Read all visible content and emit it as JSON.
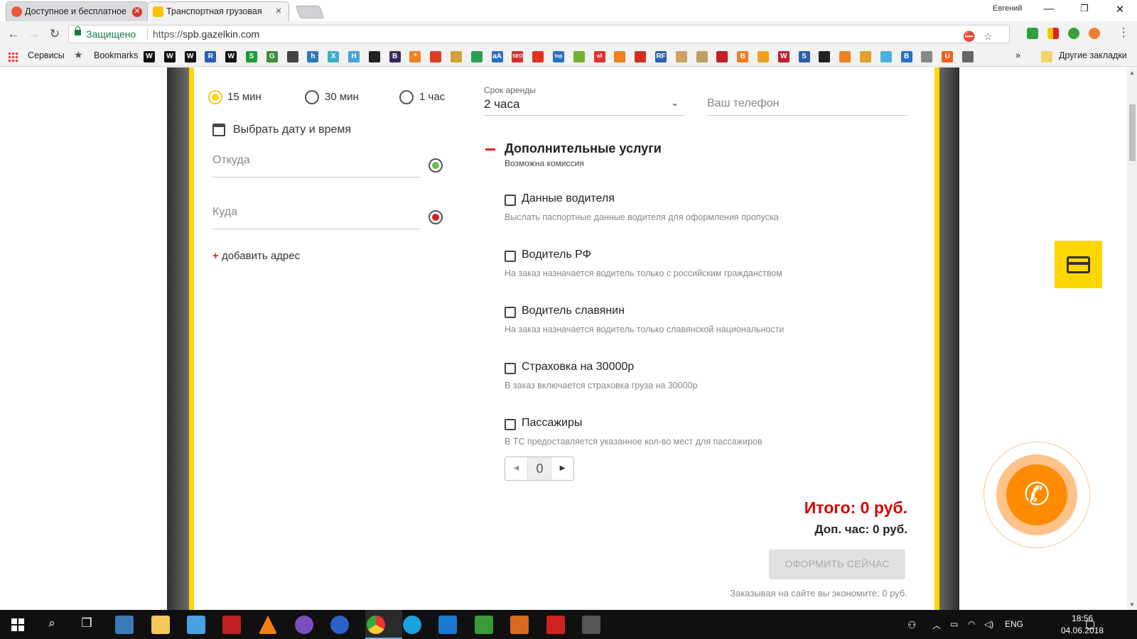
{
  "browser": {
    "tabs": [
      {
        "title": "Доступное и бесплатное",
        "favicon_color": "#e8583a"
      },
      {
        "title": "Транспортная грузовая",
        "favicon_color": "#f5c400"
      }
    ],
    "user_name": "Евгений",
    "secure_label": "Защищено",
    "url_scheme": "https://",
    "url_host": "spb.gazelkin.com"
  },
  "bookmarks": {
    "apps_label": "Сервисы",
    "bookmarks_label": "Bookmarks",
    "other_label": "Другие закладки",
    "overflow": "»",
    "icons": [
      {
        "glyph": "W",
        "color": "#111"
      },
      {
        "glyph": "W",
        "color": "#111"
      },
      {
        "glyph": "W",
        "color": "#111"
      },
      {
        "glyph": "R",
        "color": "#2a5db0"
      },
      {
        "glyph": "W",
        "color": "#111"
      },
      {
        "glyph": "S",
        "color": "#1a9e3a"
      },
      {
        "glyph": "G",
        "color": "#3a8e3a"
      },
      {
        "glyph": "",
        "color": "#444"
      },
      {
        "glyph": "h",
        "color": "#2c7ab8"
      },
      {
        "glyph": "X",
        "color": "#3bb0c9"
      },
      {
        "glyph": "H",
        "color": "#4aa0d8"
      },
      {
        "glyph": "",
        "color": "#222"
      },
      {
        "glyph": "B",
        "color": "#3a2a5c"
      },
      {
        "glyph": "*",
        "color": "#f08020"
      },
      {
        "glyph": "",
        "color": "#d84020"
      },
      {
        "glyph": "",
        "color": "#d0a040"
      },
      {
        "glyph": "",
        "color": "#2aa050"
      },
      {
        "glyph": "aA",
        "color": "#2a6ec8"
      },
      {
        "glyph": "SEO",
        "color": "#d03030"
      },
      {
        "glyph": "",
        "color": "#e03020"
      },
      {
        "glyph": "top",
        "color": "#2a70c0"
      },
      {
        "glyph": "",
        "color": "#70b030"
      },
      {
        "glyph": "all",
        "color": "#e03030"
      },
      {
        "glyph": "",
        "color": "#f08020"
      },
      {
        "glyph": "",
        "color": "#d03020"
      },
      {
        "glyph": "RF",
        "color": "#2a60b0"
      },
      {
        "glyph": "",
        "color": "#d0a060"
      },
      {
        "glyph": "",
        "color": "#c0a060"
      },
      {
        "glyph": "",
        "color": "#c02020"
      },
      {
        "glyph": "B",
        "color": "#f57c20"
      },
      {
        "glyph": "",
        "color": "#f0a020"
      },
      {
        "glyph": "W",
        "color": "#c02030"
      },
      {
        "glyph": "S",
        "color": "#2a5db0"
      },
      {
        "glyph": "",
        "color": "#222"
      },
      {
        "glyph": "",
        "color": "#f08020"
      },
      {
        "glyph": "",
        "color": "#e0a030"
      },
      {
        "glyph": "",
        "color": "#4ab0e0"
      },
      {
        "glyph": "B",
        "color": "#2a70c8"
      },
      {
        "glyph": "",
        "color": "#888"
      },
      {
        "glyph": "U",
        "color": "#f06020"
      },
      {
        "glyph": "",
        "color": "#666"
      }
    ]
  },
  "form": {
    "radio_options": [
      {
        "label": "15 мин",
        "selected": true
      },
      {
        "label": "30 мин",
        "selected": false
      },
      {
        "label": "1 час",
        "selected": false
      }
    ],
    "date_label": "Выбрать дату и время",
    "from_placeholder": "Откуда",
    "to_placeholder": "Куда",
    "add_address_plus": "+",
    "add_address_label": "добавить адрес",
    "lease_label": "Срок аренды",
    "lease_value": "2 часа",
    "phone_placeholder": "Ваш телефон",
    "extra_title": "Дополнительные услуги",
    "extra_subtitle": "Возможна комиссия",
    "options": [
      {
        "title": "Данные водителя",
        "desc": "Выслать паспортные данные водителя для оформления пропуска"
      },
      {
        "title": "Водитель РФ",
        "desc": "На заказ назначается водитель только с российским гражданством"
      },
      {
        "title": "Водитель славянин",
        "desc": "На заказ назначается водитель только славянской национальности"
      },
      {
        "title": "Страховка на 30000р",
        "desc": "В заказ включается страховка груза на 30000р"
      },
      {
        "title": "Пассажиры",
        "desc": "В ТС предоставляется указанное кол-во мест для пассажиров"
      }
    ],
    "passengers_value": "0",
    "total": "Итого: 0 руб.",
    "extra_hour": "Доп. час: 0 руб.",
    "order_button": "ОФОРМИТЬ СЕЙЧАС",
    "saving_note": "Заказывая на сайте вы экономите: 0 руб."
  },
  "taskbar": {
    "lang": "ENG",
    "time": "18:56",
    "date": "04.06.2018"
  },
  "colors": {
    "accent_yellow": "#ffd700",
    "total_red": "#d90000",
    "call_orange": "#ff8c00"
  }
}
